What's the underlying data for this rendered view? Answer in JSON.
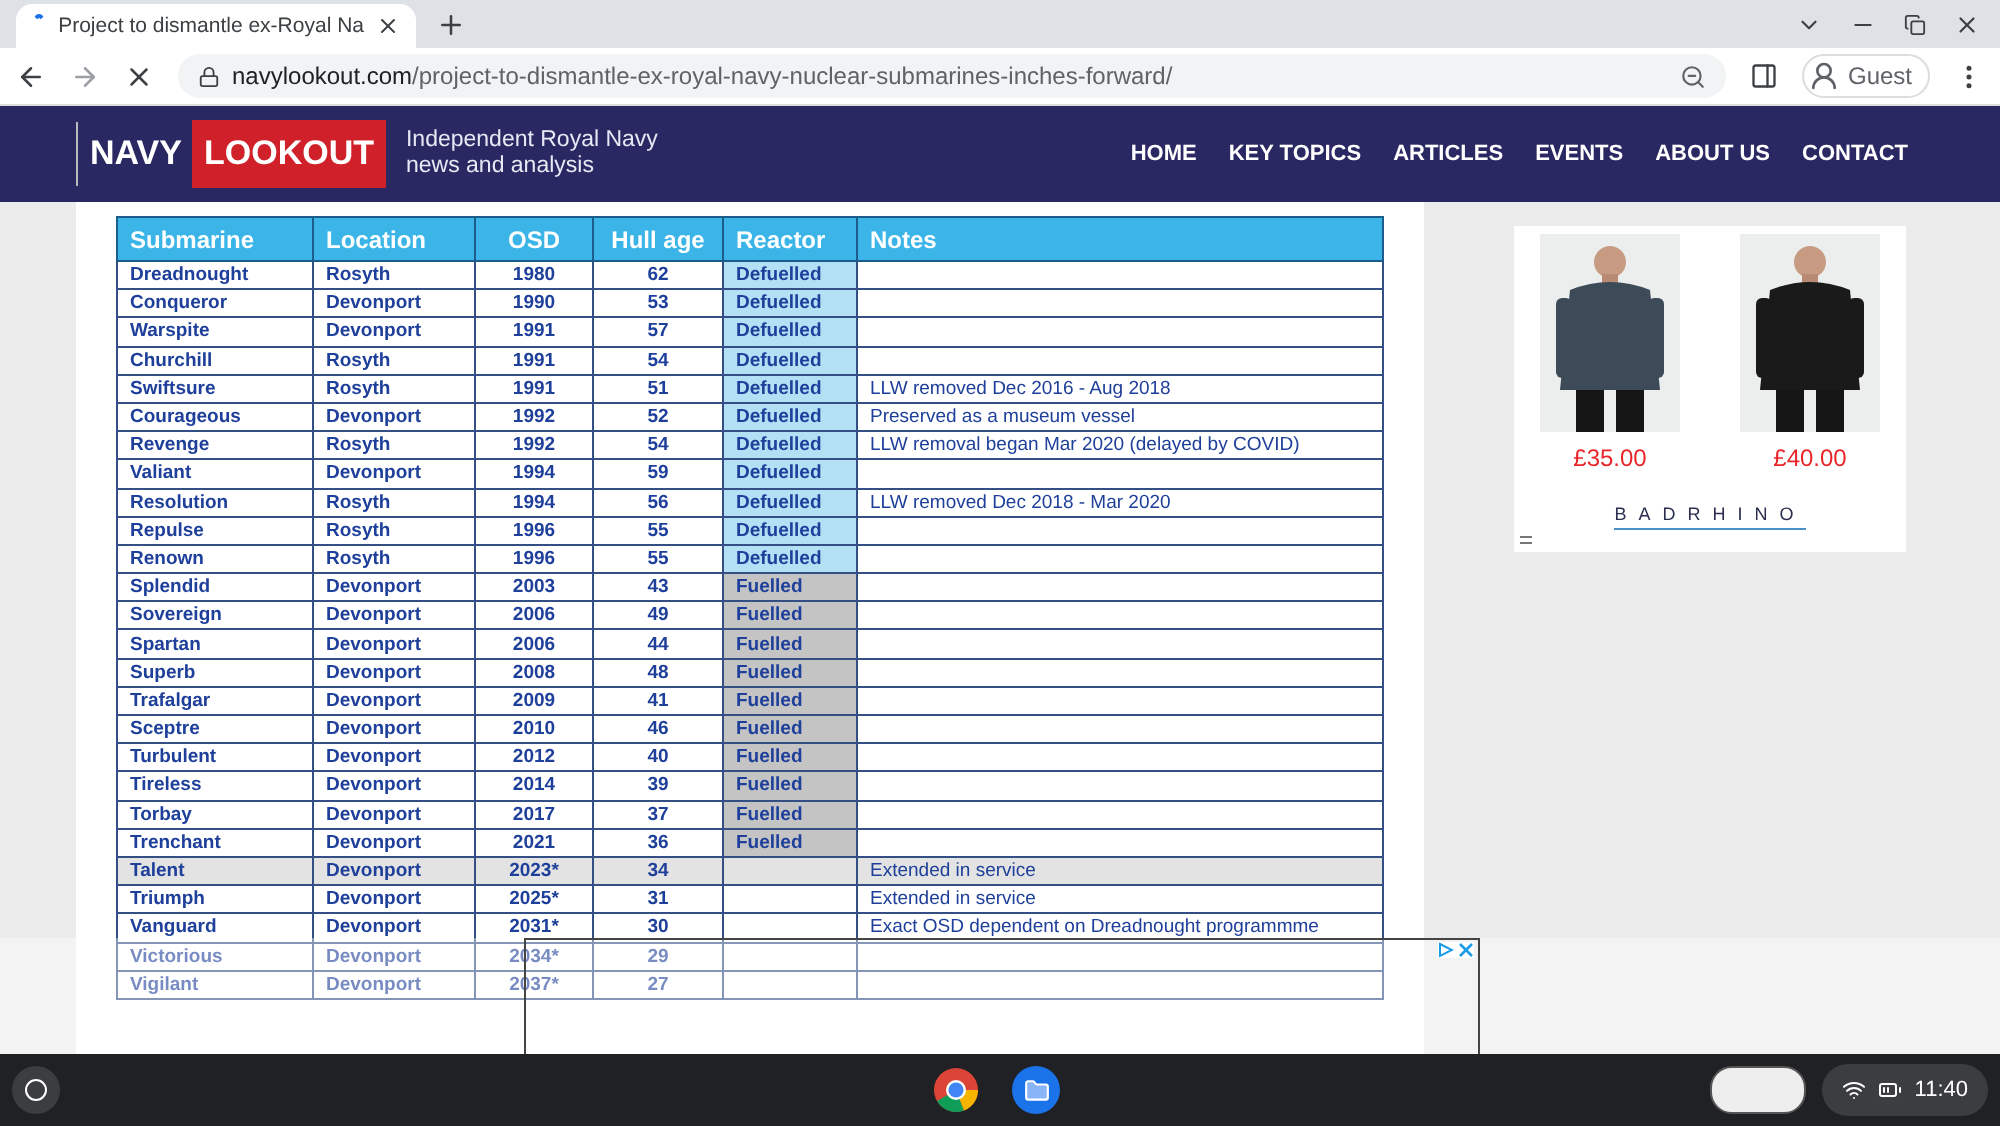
{
  "browser": {
    "tab": {
      "title": "Project to dismantle ex-Royal Na",
      "selected": true
    },
    "address": {
      "domain": "navylookout.com",
      "path": "/project-to-dismantle-ex-royal-navy-nuclear-submarines-inches-forward/"
    },
    "profile": "Guest"
  },
  "site": {
    "logo": [
      "NAVY",
      "LOOKOUT"
    ],
    "tagline": [
      "Independent Royal Navy",
      "news and analysis"
    ],
    "nav": [
      "HOME",
      "KEY TOPICS",
      "ARTICLES",
      "EVENTS",
      "ABOUT US",
      "CONTACT"
    ]
  },
  "table": {
    "columns": [
      "Submarine",
      "Location",
      "OSD",
      "Hull age",
      "Reactor",
      "Notes"
    ],
    "rows": [
      {
        "cells": [
          "Dreadnought",
          "Rosyth",
          "1980",
          "62",
          "Defuelled",
          ""
        ],
        "color": "#b3e0f5",
        "extended": false
      },
      {
        "cells": [
          "Conqueror",
          "Devonport",
          "1990",
          "53",
          "Defuelled",
          ""
        ],
        "color": "#b3e0f5",
        "extended": false
      },
      {
        "cells": [
          "Warspite",
          "Devonport",
          "1991",
          "57",
          "Defuelled",
          ""
        ],
        "color": "#b3e0f5",
        "extended": false
      },
      {
        "cells": [
          "Churchill",
          "Rosyth",
          "1991",
          "54",
          "Defuelled",
          ""
        ],
        "color": "#b3e0f5",
        "extended": false
      },
      {
        "cells": [
          "Swiftsure",
          "Rosyth",
          "1991",
          "51",
          "Defuelled",
          "LLW removed Dec 2016 - Aug 2018"
        ],
        "color": "#b3e0f5",
        "extended": false
      },
      {
        "cells": [
          "Courageous",
          "Devonport",
          "1992",
          "52",
          "Defuelled",
          "Preserved as a museum vessel"
        ],
        "color": "#b3e0f5",
        "extended": false
      },
      {
        "cells": [
          "Revenge",
          "Rosyth",
          "1992",
          "54",
          "Defuelled",
          "LLW removal began Mar 2020 (delayed by COVID)"
        ],
        "color": "#b3e0f5",
        "extended": false
      },
      {
        "cells": [
          "Valiant",
          "Devonport",
          "1994",
          "59",
          "Defuelled",
          ""
        ],
        "color": "#b3e0f5",
        "extended": false
      },
      {
        "cells": [
          "Resolution",
          "Rosyth",
          "1994",
          "56",
          "Defuelled",
          "LLW removed  Dec 2018 - Mar 2020"
        ],
        "color": "#b3e0f5",
        "extended": false
      },
      {
        "cells": [
          "Repulse",
          "Rosyth",
          "1996",
          "55",
          "Defuelled",
          ""
        ],
        "color": "#b3e0f5",
        "extended": false
      },
      {
        "cells": [
          "Renown",
          "Rosyth",
          "1996",
          "55",
          "Defuelled",
          ""
        ],
        "color": "#b3e0f5",
        "extended": false
      },
      {
        "cells": [
          "Splendid",
          "Devonport",
          "2003",
          "43",
          "Fuelled",
          ""
        ],
        "color": "#c4c4c4",
        "extended": false
      },
      {
        "cells": [
          "Sovereign",
          "Devonport",
          "2006",
          "49",
          "Fuelled",
          ""
        ],
        "color": "#c4c4c4",
        "extended": false
      },
      {
        "cells": [
          "Spartan",
          "Devonport",
          "2006",
          "44",
          "Fuelled",
          ""
        ],
        "color": "#c4c4c4",
        "extended": false
      },
      {
        "cells": [
          "Superb",
          "Devonport",
          "2008",
          "48",
          "Fuelled",
          ""
        ],
        "color": "#c4c4c4",
        "extended": false
      },
      {
        "cells": [
          "Trafalgar",
          "Devonport",
          "2009",
          "41",
          "Fuelled",
          ""
        ],
        "color": "#c4c4c4",
        "extended": false
      },
      {
        "cells": [
          "Sceptre",
          "Devonport",
          "2010",
          "46",
          "Fuelled",
          ""
        ],
        "color": "#c4c4c4",
        "extended": false
      },
      {
        "cells": [
          "Turbulent",
          "Devonport",
          "2012",
          "40",
          "Fuelled",
          ""
        ],
        "color": "#c4c4c4",
        "extended": false
      },
      {
        "cells": [
          "Tireless",
          "Devonport",
          "2014",
          "39",
          "Fuelled",
          ""
        ],
        "color": "#c4c4c4",
        "extended": false
      },
      {
        "cells": [
          "Torbay",
          "Devonport",
          "2017",
          "37",
          "Fuelled",
          ""
        ],
        "color": "#c4c4c4",
        "extended": false
      },
      {
        "cells": [
          "Trenchant",
          "Devonport",
          "2021",
          "36",
          "Fuelled",
          ""
        ],
        "color": "#c4c4c4",
        "extended": false
      },
      {
        "cells": [
          "Talent",
          "Devonport",
          "2023*",
          "34",
          "",
          "Extended in service"
        ],
        "extended": true
      },
      {
        "cells": [
          "Triumph",
          "Devonport",
          "2025*",
          "31",
          "",
          "Extended in service"
        ],
        "extended": false
      },
      {
        "cells": [
          "Vanguard",
          "Devonport",
          "2031*",
          "30",
          "",
          "Exact OSD dependent on Dreadnought programmme"
        ],
        "extended": false
      },
      {
        "cells": [
          "Victorious",
          "Devonport",
          "2034*",
          "29",
          "",
          ""
        ],
        "extended": false
      },
      {
        "cells": [
          "Vigilant",
          "Devonport",
          "2037*",
          "27",
          "",
          ""
        ],
        "extended": false
      }
    ]
  },
  "ad": {
    "products": [
      {
        "price": "£35.00",
        "kind": "picture"
      },
      {
        "price": "£40.00",
        "kind": "picture"
      }
    ],
    "brand": "BADRHINO"
  },
  "taskbar": {
    "time": "11:40"
  }
}
